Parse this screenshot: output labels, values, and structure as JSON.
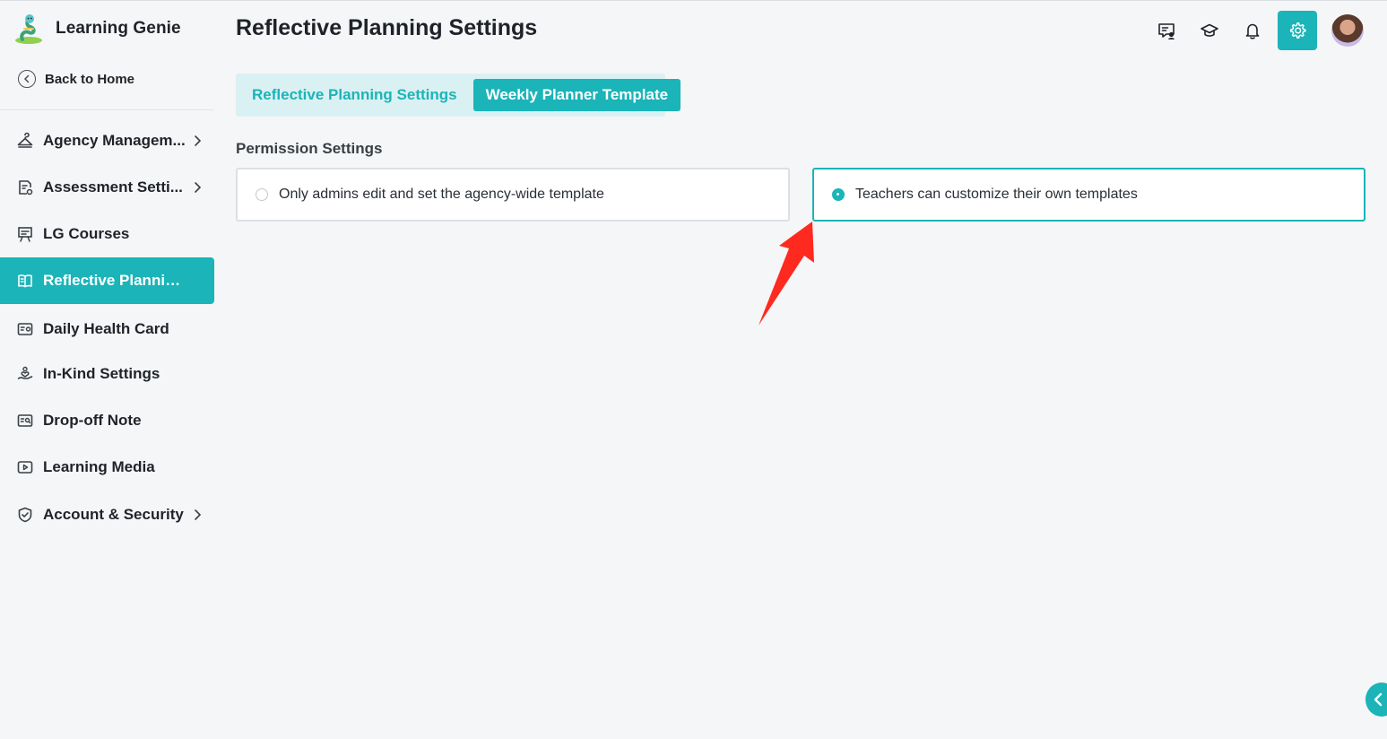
{
  "app": {
    "name": "Learning Genie",
    "back_home": "Back to Home"
  },
  "sidebar": {
    "items": [
      {
        "label": "Agency Managem...",
        "icon": "hanger-icon",
        "has_chevron": true,
        "active": false
      },
      {
        "label": "Assessment Setti...",
        "icon": "doc-gear-icon",
        "has_chevron": true,
        "active": false
      },
      {
        "label": "LG Courses",
        "icon": "presentation-icon",
        "has_chevron": false,
        "active": false
      },
      {
        "label": "Reflective Plannin...",
        "icon": "open-book-icon",
        "has_chevron": false,
        "active": true
      },
      {
        "label": "Daily Health Card",
        "icon": "health-card-icon",
        "has_chevron": false,
        "active": false
      },
      {
        "label": "In-Kind Settings",
        "icon": "hand-heart-icon",
        "has_chevron": false,
        "active": false
      },
      {
        "label": "Drop-off Note",
        "icon": "note-search-icon",
        "has_chevron": false,
        "active": false
      },
      {
        "label": "Learning Media",
        "icon": "play-icon",
        "has_chevron": false,
        "active": false
      },
      {
        "label": "Account & Security",
        "icon": "shield-check-icon",
        "has_chevron": true,
        "active": false
      }
    ]
  },
  "header": {
    "title": "Reflective Planning Settings",
    "icons": [
      "chat-user-icon",
      "graduation-cap-icon",
      "bell-icon",
      "gear-icon"
    ]
  },
  "tabs": [
    {
      "label": "Reflective Planning Settings",
      "active": false
    },
    {
      "label": "Weekly Planner Template",
      "active": true
    }
  ],
  "permission": {
    "label": "Permission Settings",
    "options": [
      {
        "label": "Only admins edit and set the agency-wide template",
        "selected": false
      },
      {
        "label": "Teachers can customize their own templates",
        "selected": true
      }
    ]
  },
  "colors": {
    "accent": "#1bb4b8",
    "annotation_arrow": "#ff2a1f"
  }
}
